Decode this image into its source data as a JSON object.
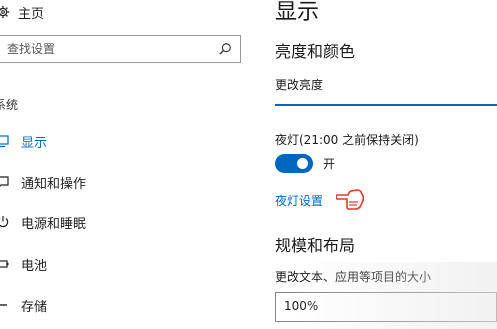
{
  "sidebar": {
    "home_label": "主页",
    "search_placeholder": "查找设置",
    "section_label": "系统",
    "items": [
      {
        "label": "显示",
        "icon": "monitor-icon",
        "active": true
      },
      {
        "label": "通知和操作",
        "icon": "message-icon",
        "active": false
      },
      {
        "label": "电源和睡眠",
        "icon": "power-icon",
        "active": false
      },
      {
        "label": "电池",
        "icon": "battery-icon",
        "active": false
      },
      {
        "label": "存储",
        "icon": "storage-icon",
        "active": false
      }
    ]
  },
  "main": {
    "title": "显示",
    "brightness_heading": "亮度和颜色",
    "brightness_label": "更改亮度",
    "nightlight_label": "夜灯(21:00 之前保持关闭)",
    "toggle_state": "开",
    "nightlight_link": "夜灯设置",
    "layout_heading": "规模和布局",
    "scale_label": "更改文本、应用等项目的大小",
    "scale_value": "100%"
  },
  "colors": {
    "accent": "#0067c0",
    "hand_pointer": "#e03a2b"
  }
}
